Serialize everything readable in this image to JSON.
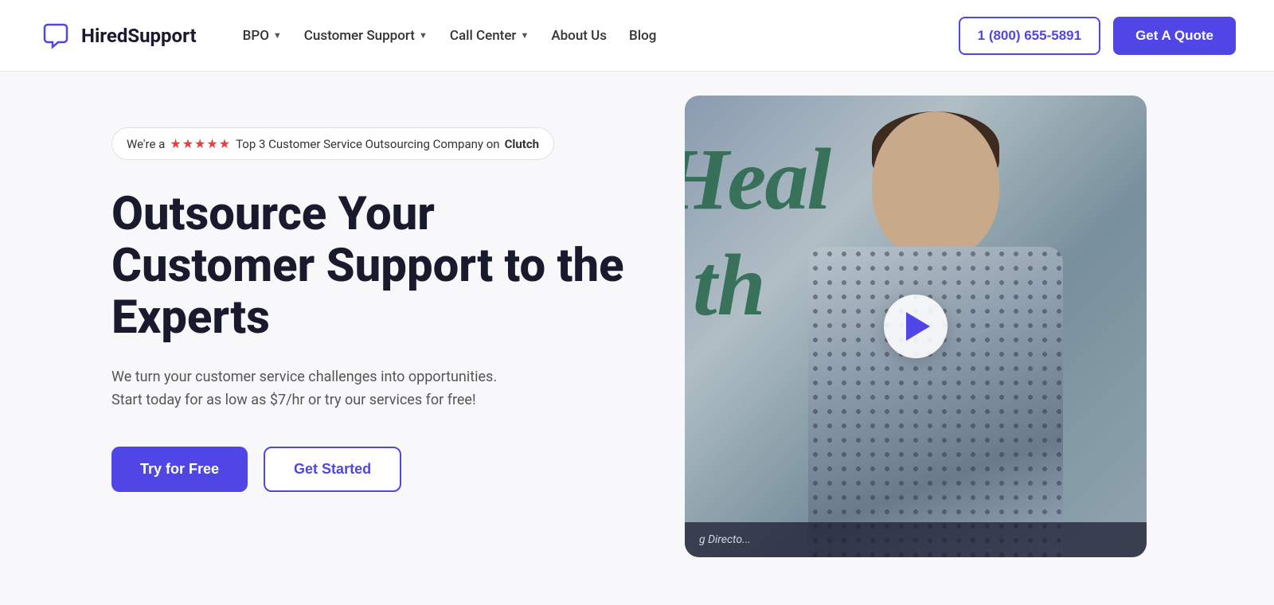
{
  "navbar": {
    "logo_text": "HiredSupport",
    "nav_items": [
      {
        "label": "BPO",
        "has_dropdown": true
      },
      {
        "label": "Customer Support",
        "has_dropdown": true
      },
      {
        "label": "Call Center",
        "has_dropdown": true
      },
      {
        "label": "About Us",
        "has_dropdown": false
      },
      {
        "label": "Blog",
        "has_dropdown": false
      }
    ],
    "phone_label": "1 (800) 655-5891",
    "quote_label": "Get A Quote"
  },
  "hero": {
    "badge_text": "We're a",
    "badge_stars": "★★★★★",
    "badge_middle": "Top 3 Customer Service Outsourcing Company on",
    "badge_clutch": "Clutch",
    "title": "Outsource Your Customer Support to the Experts",
    "subtitle": "We turn your customer service challenges into opportunities. Start today for as low as $7/hr or try our services for free!",
    "try_free_label": "Try for Free",
    "get_started_label": "Get Started",
    "video_caption": "g Directo..."
  }
}
